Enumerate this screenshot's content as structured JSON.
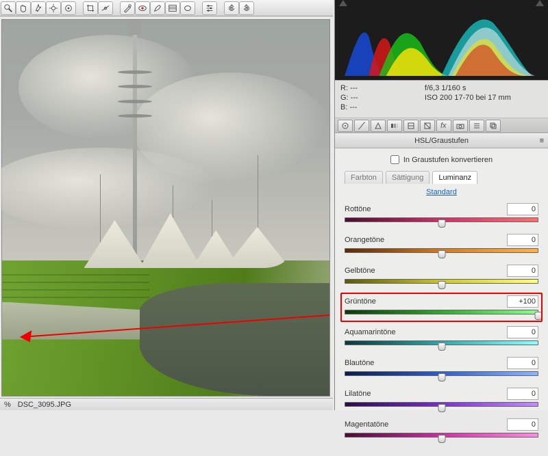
{
  "info": {
    "r": "R:   ---",
    "g": "G:   ---",
    "b": "B:   ---",
    "aperture": "f/6,3   1/160 s",
    "iso": "ISO 200   17-70 bei 17 mm"
  },
  "panel_title": "HSL/Graustufen",
  "grayscale_label": "In Graustufen konvertieren",
  "tabs": {
    "hue": "Farbton",
    "sat": "Sättigung",
    "lum": "Luminanz"
  },
  "standard": "Standard",
  "sliders": [
    {
      "label": "Rottöne",
      "value": "0",
      "pos": 50,
      "g": "linear-gradient(90deg,#4f0e2e,#d12e6a,#ff6f6f)"
    },
    {
      "label": "Orangetöne",
      "value": "0",
      "pos": 50,
      "g": "linear-gradient(90deg,#5a2b08,#d77a1e,#ffb24a)"
    },
    {
      "label": "Gelbtöne",
      "value": "0",
      "pos": 50,
      "g": "linear-gradient(90deg,#5a5a0a,#c8c828,#ffff7a)"
    },
    {
      "label": "Grüntöne",
      "value": "+100",
      "pos": 100,
      "g": "linear-gradient(90deg,#0c3a0c,#2fa92f,#8cff8c)",
      "hl": true
    },
    {
      "label": "Aquamarintöne",
      "value": "0",
      "pos": 50,
      "g": "linear-gradient(90deg,#0c3a3a,#2fa9a9,#8cffff)"
    },
    {
      "label": "Blautöne",
      "value": "0",
      "pos": 50,
      "g": "linear-gradient(90deg,#0c1c4a,#2f5fd1,#8cb4ff)"
    },
    {
      "label": "Lilatöne",
      "value": "0",
      "pos": 50,
      "g": "linear-gradient(90deg,#2a0c4a,#7a2fd1,#c48cff)"
    },
    {
      "label": "Magentatöne",
      "value": "0",
      "pos": 50,
      "g": "linear-gradient(90deg,#4a0c38,#d12fa6,#ff8ce1)"
    }
  ],
  "footer": {
    "pct": "%",
    "file": "DSC_3095.JPG"
  }
}
